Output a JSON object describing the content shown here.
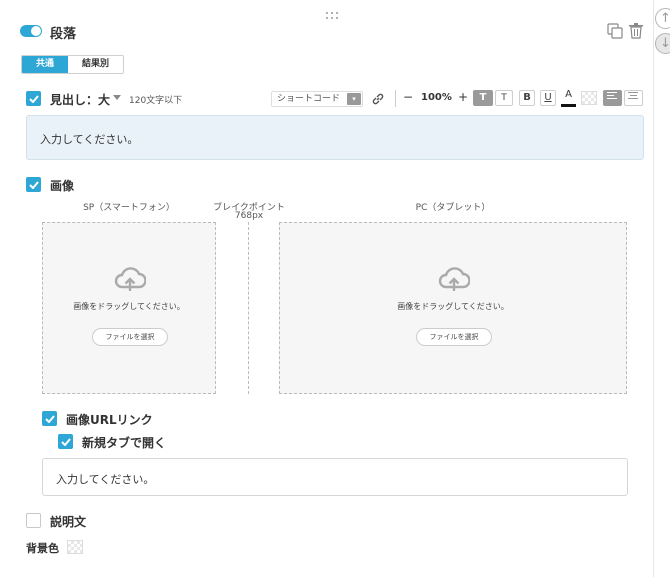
{
  "header": {
    "title": "段落",
    "toggle_on": true,
    "up_arrow": "↑",
    "down_arrow": "↓"
  },
  "tabs": [
    {
      "label": "共通",
      "active": true
    },
    {
      "label": "結果別",
      "active": false
    }
  ],
  "heading": {
    "label": "見出し：大",
    "limit": "120文字以下",
    "placeholder": "入力してください。"
  },
  "toolbar": {
    "shortcode_label": "ショートコード",
    "shortcode_caret": "▾",
    "minus": "−",
    "zoom": "100%",
    "plus": "+",
    "text_large": "T",
    "text_small": "T",
    "bold": "B",
    "underline": "U",
    "font_color": "A",
    "accent_color": "#2ea6d6"
  },
  "image": {
    "label": "画像",
    "sp_label": "SP（スマートフォン）",
    "breakpoint_label": "ブレイクポイント",
    "breakpoint_value": "768px",
    "pc_label": "PC（タブレット）",
    "drop_text": "画像をドラッグしてください。",
    "file_button": "ファイルを選択"
  },
  "image_url_link": {
    "label": "画像URLリンク",
    "new_tab_label": "新規タブで開く",
    "placeholder": "入力してください。"
  },
  "description": {
    "label": "説明文"
  },
  "background_color": {
    "label": "背景色"
  }
}
